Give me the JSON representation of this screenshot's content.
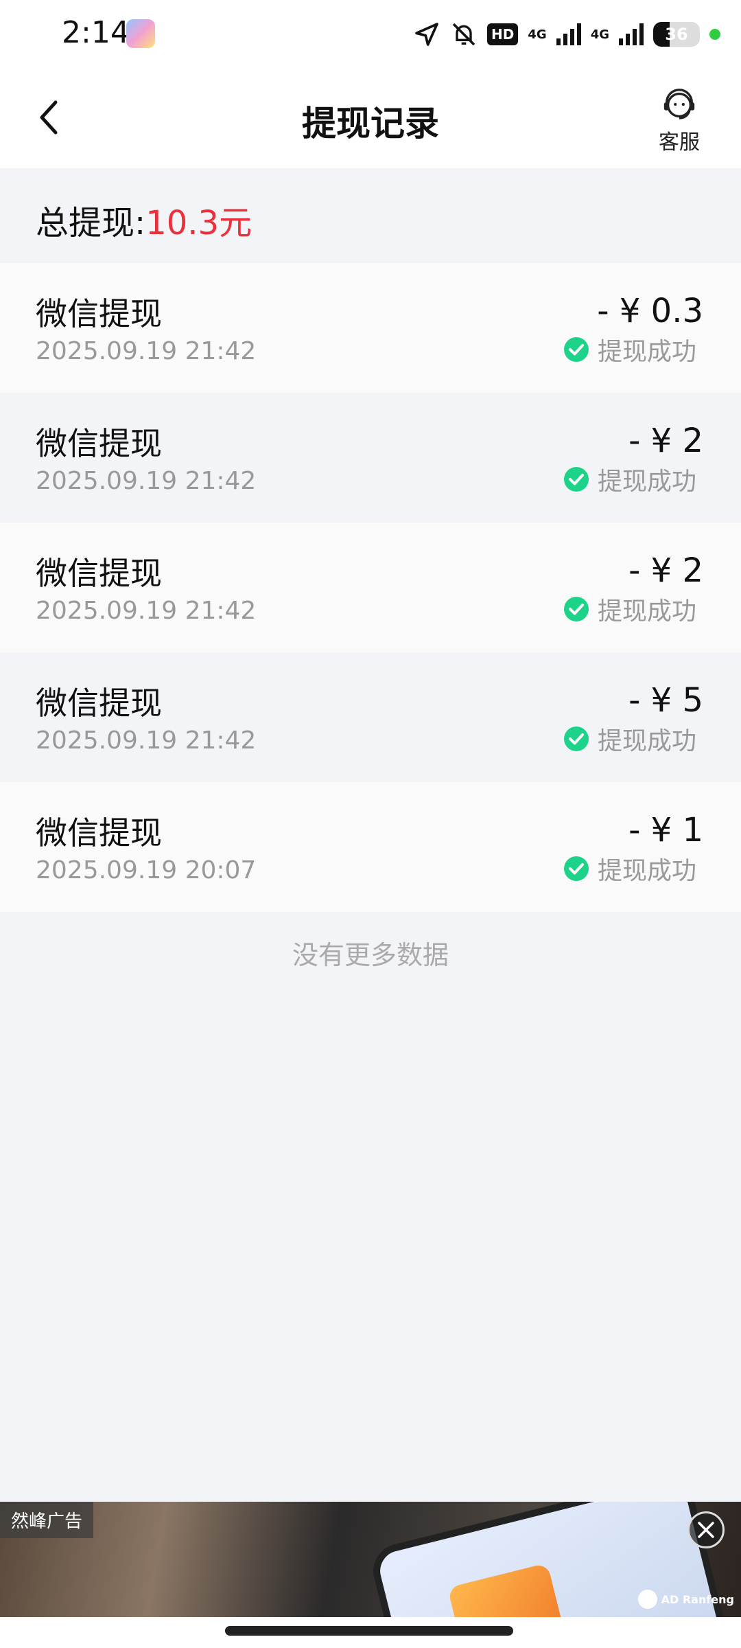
{
  "status_bar": {
    "time": "2:14",
    "network": "4G",
    "network2": "4G",
    "hd_label": "HD",
    "battery_level": "36",
    "battery_fraction": 0.36,
    "icons": [
      "location-icon",
      "bell-muted-icon",
      "hd-icon",
      "signal-icon",
      "signal-icon",
      "battery-icon"
    ]
  },
  "nav": {
    "title": "提现记录",
    "service_label": "客服",
    "back_icon": "back-arrow-icon",
    "service_icon": "headset-icon"
  },
  "summary": {
    "label": "总提现:",
    "value": "10.3元"
  },
  "records": [
    {
      "title": "微信提现",
      "time": "2025.09.19 21:42",
      "amount": "- ¥ 0.3",
      "status": "提现成功"
    },
    {
      "title": "微信提现",
      "time": "2025.09.19 21:42",
      "amount": "- ¥ 2",
      "status": "提现成功"
    },
    {
      "title": "微信提现",
      "time": "2025.09.19 21:42",
      "amount": "- ¥ 2",
      "status": "提现成功"
    },
    {
      "title": "微信提现",
      "time": "2025.09.19 21:42",
      "amount": "- ¥ 5",
      "status": "提现成功"
    },
    {
      "title": "微信提现",
      "time": "2025.09.19 20:07",
      "amount": "- ¥ 1",
      "status": "提现成功"
    }
  ],
  "footer_text": "没有更多数据",
  "ad": {
    "label": "然峰广告",
    "brand": "AD Ranfeng",
    "close_icon": "close-icon"
  },
  "colors": {
    "accent_red": "#e8313c",
    "success_green": "#1dd38a",
    "page_bg": "#f3f4f8"
  }
}
